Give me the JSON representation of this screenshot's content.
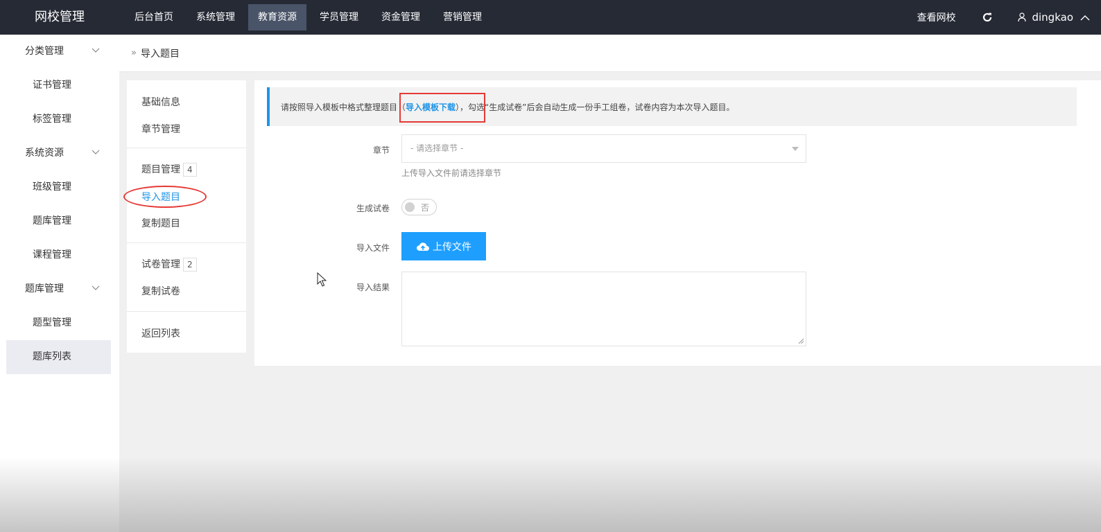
{
  "brand": "网校管理",
  "nav": [
    "后台首页",
    "系统管理",
    "教育资源",
    "学员管理",
    "资金管理",
    "营销管理"
  ],
  "nav_active": "教育资源",
  "top_right": {
    "view_site": "查看网校",
    "username": "dingkao"
  },
  "sidebar": [
    {
      "label": "分类管理",
      "kind": "group"
    },
    {
      "label": "证书管理",
      "kind": "child"
    },
    {
      "label": "标签管理",
      "kind": "child"
    },
    {
      "label": "系统资源",
      "kind": "group"
    },
    {
      "label": "班级管理",
      "kind": "child"
    },
    {
      "label": "题库管理",
      "kind": "child"
    },
    {
      "label": "课程管理",
      "kind": "child"
    },
    {
      "label": "题库管理",
      "kind": "group"
    },
    {
      "label": "题型管理",
      "kind": "child"
    },
    {
      "label": "题库列表",
      "kind": "child",
      "active": true
    }
  ],
  "breadcrumb": {
    "arrows": "»",
    "current": "导入题目"
  },
  "submenu": {
    "basic_info": "基础信息",
    "chapter_mgmt": "章节管理",
    "question_mgmt": "题目管理",
    "question_count": "4",
    "import_questions": "导入题目",
    "copy_questions": "复制题目",
    "paper_mgmt": "试卷管理",
    "paper_count": "2",
    "copy_paper": "复制试卷",
    "back_to_list": "返回列表"
  },
  "notice": {
    "before": "请按照导入模板中格式整理题目（",
    "link": "导入模板下载",
    "after": "），勾选“生成试卷”后会自动生成一份手工组卷，试卷内容为本次导入题目。"
  },
  "form": {
    "chapter_label": "章节",
    "chapter_placeholder": "- 请选择章节 -",
    "chapter_hint": "上传导入文件前请选择章节",
    "gen_paper_label": "生成试卷",
    "gen_paper_value": "否",
    "import_file_label": "导入文件",
    "upload_button": "上传文件",
    "result_label": "导入结果",
    "result_value": ""
  },
  "colors": {
    "topbar": "#262a35",
    "accent": "#1e95e8",
    "upload": "#1e9fff",
    "annotation": "#e53935"
  }
}
